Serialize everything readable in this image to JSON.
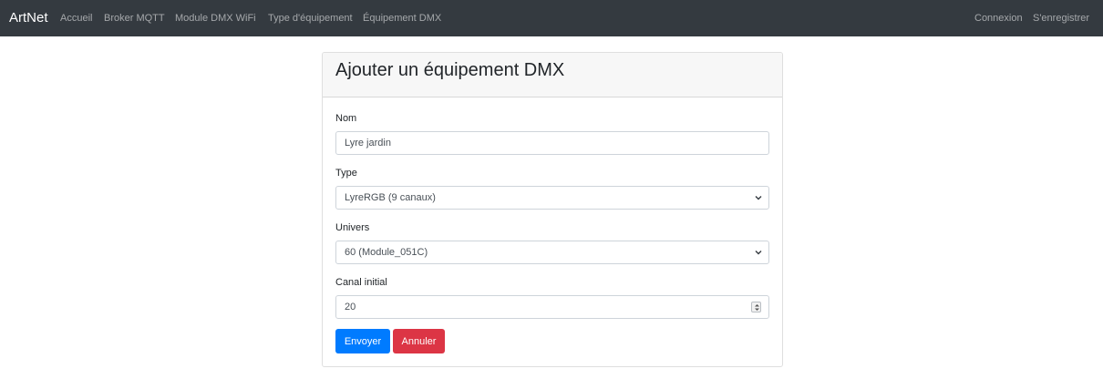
{
  "navbar": {
    "brand": "ArtNet",
    "links": [
      "Accueil",
      "Broker MQTT",
      "Module DMX WiFi",
      "Type d'équipement",
      "Équipement DMX"
    ],
    "right_links": [
      "Connexion",
      "S'enregistrer"
    ]
  },
  "card": {
    "title": "Ajouter un équipement DMX",
    "fields": {
      "nom": {
        "label": "Nom",
        "value": "Lyre jardin"
      },
      "type": {
        "label": "Type",
        "selected": "LyreRGB (9 canaux)"
      },
      "univers": {
        "label": "Univers",
        "selected": "60 (Module_051C)"
      },
      "canal": {
        "label": "Canal initial",
        "value": "20"
      }
    },
    "buttons": {
      "submit": "Envoyer",
      "cancel": "Annuler"
    }
  },
  "colors": {
    "navbar": "#343a40",
    "primary": "#007bff",
    "danger": "#dc3545"
  }
}
